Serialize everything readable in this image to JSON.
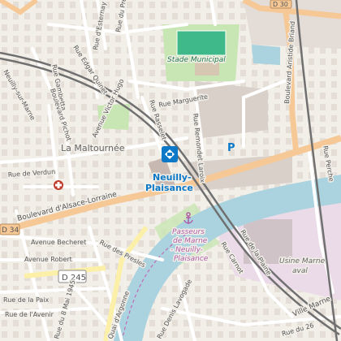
{
  "map": {
    "streets": {
      "victor_hugo": "Avenue Victor Hugo",
      "edgar_quinet": "Rue Edgar Quinet",
      "esternay": "Rue d'Esternay",
      "pre": "Rue du Pré",
      "marguerite": "Rue Marguerite",
      "rasselet": "Rue Rasselet",
      "remondet": "Rue Remondet Laroix",
      "gambetta": "Rue Gambetta",
      "pichot": "Boulevard Pichot",
      "verdun": "Rue de Verdun",
      "alsace": "Boulevard d'Alsace-Lorraine",
      "becheret": "Avenue Becheret",
      "robert": "Avenue Robert",
      "presles": "Rue des Presles",
      "paix": "Rue de la Paix",
      "avenir": "Rue de l'Avenir",
      "mai1945": "Rue du 8 Mai 1945",
      "argonne": "Quai d'Argonne",
      "lavogade": "Rue Denis Lavogade",
      "aristide": "Boulevard Aristide Briand",
      "perche": "Rue Perche",
      "plaine": "Rue de la Plaine",
      "neuilly_marne": "Neuilly-sur-Marne",
      "rue_26": "Rue du 26",
      "ville_marne": "Ville Marne",
      "rue_carnot": "Rue Carnot"
    },
    "places": {
      "stade": "Stade Municipal",
      "maltournee": "La Maltournée",
      "station_line1": "Neuilly-",
      "station_line2": "Plaisance",
      "passeurs_1": "Passeurs",
      "passeurs_2": "de Marne",
      "passeurs_3": "- Neuilly-",
      "passeurs_4": "Plaisance",
      "usine_1": "Usine Marne",
      "usine_2": "aval"
    },
    "roads": {
      "d34": "D 34",
      "d245": "D 245",
      "d30": "D 30"
    },
    "parking": "P",
    "colors": {
      "background": "#f2efe9",
      "primary_road": "#f6c896",
      "water": "#aad3df",
      "park": "#c8e6b4",
      "pitch": "#3fb98a",
      "industrial": "#ebdbe8",
      "building": "#d9d0c9",
      "rail": "#707070",
      "poi_blue": "#0b78c8",
      "poi_red": "#c0392b"
    },
    "icons": [
      "train-station-icon",
      "hospital-icon",
      "anchor-icon",
      "parking-icon"
    ]
  }
}
